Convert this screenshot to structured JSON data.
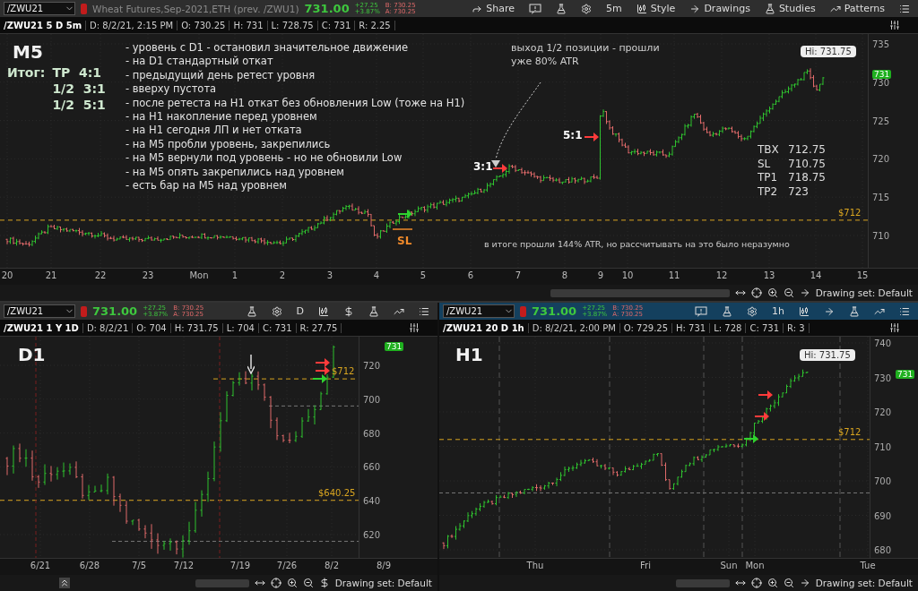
{
  "main": {
    "active": false,
    "toolbar": [
      {
        "kind": "symbol",
        "value": "/ZWU21"
      },
      {
        "kind": "alert"
      },
      {
        "kind": "description",
        "text": "Wheat Futures,Sep-2021,ETH (prev. /ZWU1)"
      },
      {
        "kind": "price",
        "text": "731.00"
      },
      {
        "kind": "change",
        "lines": [
          "+27.25",
          "+3.87%"
        ]
      },
      {
        "kind": "quote",
        "lines": [
          "B: 730.25",
          "A: 730.25"
        ]
      },
      {
        "kind": "share",
        "label": "Share"
      },
      {
        "kind": "alert-button"
      },
      {
        "kind": "flask"
      },
      {
        "kind": "gear"
      },
      {
        "kind": "interval",
        "label": "5m"
      },
      {
        "kind": "style",
        "label": "Style"
      },
      {
        "kind": "drawings",
        "label": "Drawings"
      },
      {
        "kind": "studies",
        "label": "Studies"
      },
      {
        "kind": "patterns",
        "label": "Patterns"
      },
      {
        "kind": "menu"
      }
    ],
    "info": [
      "/ZWU21 5 D 5m",
      "D: 8/2/21, 2:15 PM",
      "O: 730.25",
      "H: 731",
      "L: 728.75",
      "C: 731",
      "R: 2.25"
    ],
    "chart": {
      "title": "M5",
      "summary": {
        "label": "Итог:",
        "lines": [
          "TP  4:1",
          "1/2  3:1",
          "1/2  5:1"
        ]
      },
      "notes": [
        "- уровень с D1 - остановил значительное движение",
        "- на D1 стандартный откат",
        "- предыдущий день ретест уровня",
        "- вверху пустота",
        "- после ретеста на H1 откат без обновления Low (тоже на H1)",
        "- на H1 накопление перед уровнем",
        "- на H1 сегодня ЛП и нет отката",
        "- на M5 пробли уровень, закрепились",
        "- на M5 вернули под уровень - но не обновили Low",
        "- на M5 опять закрепились над уровнем",
        "- есть бар на M5 над уровнем"
      ],
      "callout": "выход 1/2 позиции - прошли уже 80% ATR",
      "markers": [
        "3:1",
        "5:1"
      ],
      "stop_label": "SL",
      "levels": [
        {
          "name": "TBX",
          "value": "712.75"
        },
        {
          "name": "SL",
          "value": "710.75"
        },
        {
          "name": "TP1",
          "value": "718.75"
        },
        {
          "name": "TP2",
          "value": "723"
        }
      ],
      "bottom_note": "в итоге прошли 144% ATR, но рассчитывать на это было неразумно",
      "high_label": "Hi: 731.75",
      "price_tag": "731",
      "level_labels": [
        "$712"
      ],
      "price_axis": [
        "735",
        "730",
        "725",
        "720",
        "715",
        "710"
      ],
      "time_axis": [
        "20",
        "21",
        "22",
        "23",
        "Mon",
        "1",
        "2",
        "3",
        "4",
        "5",
        "6",
        "7",
        "8",
        "9",
        "10",
        "11",
        "12",
        "13",
        "14",
        "15"
      ]
    },
    "footer": "Drawing set: Default"
  },
  "daily": {
    "active": false,
    "toolbar": [
      {
        "kind": "symbol",
        "value": "/ZWU21"
      },
      {
        "kind": "alert"
      },
      {
        "kind": "price",
        "text": "731.00"
      },
      {
        "kind": "change",
        "lines": [
          "+27.25",
          "+3.87%"
        ]
      },
      {
        "kind": "quote",
        "lines": [
          "B: 730.25",
          "A: 730.25"
        ]
      },
      {
        "kind": "flask"
      },
      {
        "kind": "gear"
      },
      {
        "kind": "interval",
        "label": "D"
      },
      {
        "kind": "candles"
      },
      {
        "kind": "dollar"
      },
      {
        "kind": "flask"
      },
      {
        "kind": "patterns"
      },
      {
        "kind": "menu"
      }
    ],
    "info": [
      "/ZWU21 1 Y 1D",
      "D: 8/2/21",
      "O: 704",
      "H: 731.75",
      "L: 704",
      "C: 731",
      "R: 27.75"
    ],
    "chart": {
      "title": "D1",
      "price_tag": "731",
      "level_labels": [
        "$712",
        "$640.25"
      ],
      "price_axis": [
        "720",
        "700",
        "680",
        "660",
        "640",
        "620"
      ],
      "time_axis": [
        "6/21",
        "6/28",
        "7/5",
        "7/12",
        "7/19",
        "7/26",
        "8/2",
        "8/9"
      ]
    },
    "footer": "Drawing set: Default"
  },
  "hourly": {
    "active": true,
    "toolbar": [
      {
        "kind": "symbol",
        "value": "/ZWU21"
      },
      {
        "kind": "alert"
      },
      {
        "kind": "price",
        "text": "731.00"
      },
      {
        "kind": "change",
        "lines": [
          "+27.25",
          "+3.87%"
        ]
      },
      {
        "kind": "quote",
        "lines": [
          "B: 730.25",
          "A: 730.25"
        ]
      },
      {
        "kind": "alert-button"
      },
      {
        "kind": "flask"
      },
      {
        "kind": "gear"
      },
      {
        "kind": "interval",
        "label": "1h"
      },
      {
        "kind": "candles"
      },
      {
        "kind": "arrow"
      },
      {
        "kind": "flask"
      },
      {
        "kind": "patterns"
      },
      {
        "kind": "menu"
      }
    ],
    "info": [
      "/ZWU21 20 D 1h",
      "D: 8/2/21, 2:00 PM",
      "O: 729.25",
      "H: 731",
      "L: 728",
      "C: 731",
      "R: 3"
    ],
    "chart": {
      "title": "H1",
      "high_label": "Hi: 731.75",
      "price_tag": "731",
      "level_labels": [
        "$712"
      ],
      "price_axis": [
        "740",
        "730",
        "720",
        "710",
        "700",
        "690",
        "680"
      ],
      "time_axis": [
        "Thu",
        "Fri",
        "Sun",
        "Mon",
        "Tue"
      ]
    },
    "footer": "Drawing set: Default"
  }
}
